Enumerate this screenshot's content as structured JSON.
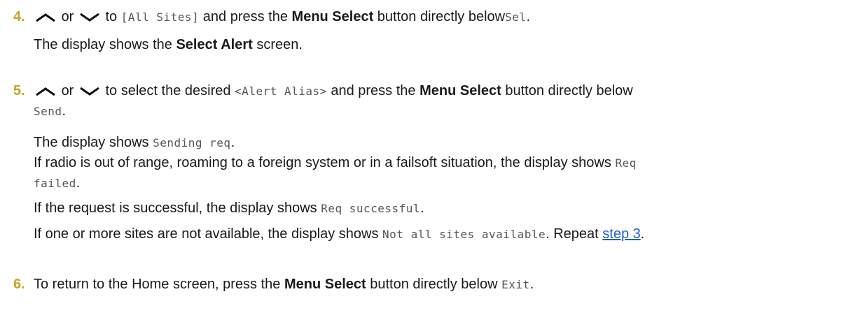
{
  "icons": {
    "up": "chevron-up-icon",
    "down": "chevron-down-icon"
  },
  "colors": {
    "step_number": "#c9a227",
    "link": "#1f5ad6",
    "mono": "#555555"
  },
  "steps": [
    {
      "number": "4.",
      "l1_or": "or",
      "l1_to": "to",
      "l1_code": "[All Sites]",
      "l1_press": "and press the",
      "l1_btn": "Menu Select",
      "l1_below": "button directly below",
      "l1_code2": "Sel",
      "l1_dot": ".",
      "l2_a": "The display shows the",
      "l2_b": "Select Alert",
      "l2_c": "screen."
    },
    {
      "number": "5.",
      "l1_or": "or",
      "l1_to": "to select the desired",
      "l1_code": "<Alert Alias>",
      "l1_press": "and press the",
      "l1_btn": "Menu Select",
      "l1_below": "button directly below",
      "l2_code": "Send",
      "l2_dot": ".",
      "l3_a": "The display shows",
      "l3_code": "Sending req",
      "l3_dot": ".",
      "l4_a": "If radio is out of range, roaming to a foreign system or in a failsoft situation, the display shows",
      "l4_code": "Req",
      "l5_code": "failed",
      "l5_dot": ".",
      "l6_a": "If the request is successful, the display shows",
      "l6_code": "Req successful",
      "l6_dot": ".",
      "l7_a": "If one or more sites are not available, the display shows",
      "l7_code": "Not all sites available",
      "l7_b": ". Repeat",
      "l7_link": "step 3",
      "l7_dot": "."
    },
    {
      "number": "6.",
      "l1_a": "To return to the Home screen, press the",
      "l1_btn": "Menu Select",
      "l1_below": "button directly below",
      "l1_code": "Exit",
      "l1_dot": "."
    }
  ]
}
